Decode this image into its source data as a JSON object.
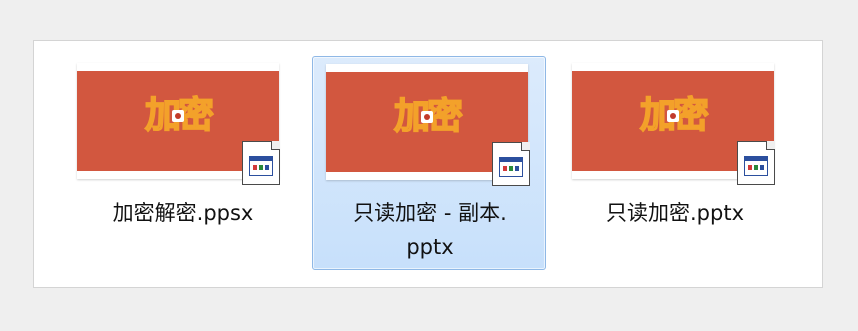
{
  "files": [
    {
      "name": "加密解密.ppsx",
      "thumbnail_text": [
        "加",
        "密"
      ],
      "selected": false
    },
    {
      "name_line1": "只读加密 - 副本.",
      "name_line2": "pptx",
      "thumbnail_text": [
        "加",
        "密"
      ],
      "selected": true
    },
    {
      "name": "只读加密.pptx",
      "thumbnail_text": [
        "加",
        "密"
      ],
      "selected": false
    }
  ],
  "colors": {
    "thumbnail_band": "#d2573f",
    "thumbnail_text_outline": "#f3a12a",
    "selection_fill": "#cfe4fb",
    "selection_border": "#8fb8e6",
    "window_background": "#efefef"
  },
  "icons": {
    "file_type_badge": "presentation-file-icon"
  }
}
